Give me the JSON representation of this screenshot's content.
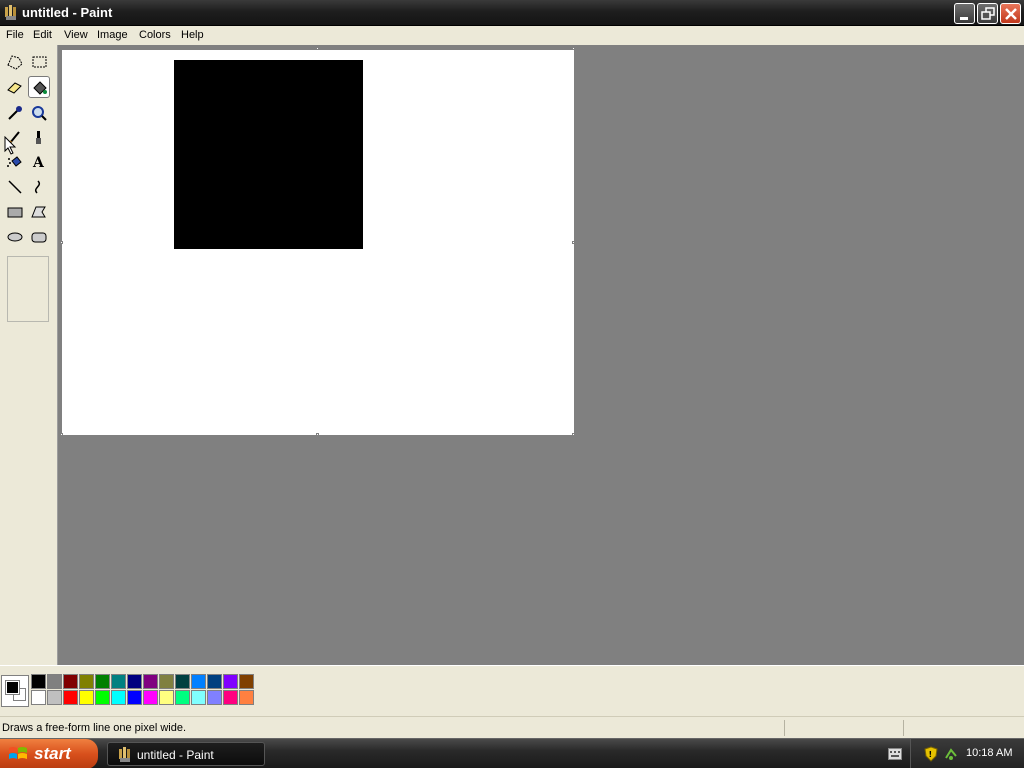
{
  "window": {
    "title": "untitled - Paint"
  },
  "menu": {
    "items": [
      "File",
      "Edit",
      "View",
      "Image",
      "Colors",
      "Help"
    ]
  },
  "tools": [
    {
      "name": "free-form-select",
      "icon": "free-select-icon"
    },
    {
      "name": "select",
      "icon": "rect-select-icon"
    },
    {
      "name": "eraser",
      "icon": "eraser-icon"
    },
    {
      "name": "fill-with-color",
      "icon": "fill-bucket-icon",
      "selected": true
    },
    {
      "name": "pick-color",
      "icon": "eyedropper-icon"
    },
    {
      "name": "magnifier",
      "icon": "magnifier-icon"
    },
    {
      "name": "pencil",
      "icon": "pencil-icon"
    },
    {
      "name": "brush",
      "icon": "brush-icon"
    },
    {
      "name": "airbrush",
      "icon": "airbrush-icon"
    },
    {
      "name": "text",
      "icon": "text-icon"
    },
    {
      "name": "line",
      "icon": "line-icon"
    },
    {
      "name": "curve",
      "icon": "curve-icon"
    },
    {
      "name": "rectangle",
      "icon": "rectangle-icon"
    },
    {
      "name": "polygon",
      "icon": "polygon-icon"
    },
    {
      "name": "ellipse",
      "icon": "ellipse-icon"
    },
    {
      "name": "rounded-rectangle",
      "icon": "rounded-rect-icon"
    }
  ],
  "palette": {
    "foreground": "#000000",
    "background": "#FFFFFF",
    "row1": [
      "#000000",
      "#808080",
      "#800000",
      "#808000",
      "#008000",
      "#008080",
      "#000080",
      "#800080",
      "#808040",
      "#004040",
      "#0080FF",
      "#004080",
      "#8000FF",
      "#804000"
    ],
    "row2": [
      "#FFFFFF",
      "#C0C0C0",
      "#FF0000",
      "#FFFF00",
      "#00FF00",
      "#00FFFF",
      "#0000FF",
      "#FF00FF",
      "#FFFF80",
      "#00FF80",
      "#80FFFF",
      "#8080FF",
      "#FF0080",
      "#FF8040"
    ]
  },
  "status": {
    "text": "Draws a free-form line one pixel wide."
  },
  "taskbar": {
    "start_label": "start",
    "task_label": "untitled - Paint",
    "clock": "10:18 AM"
  }
}
